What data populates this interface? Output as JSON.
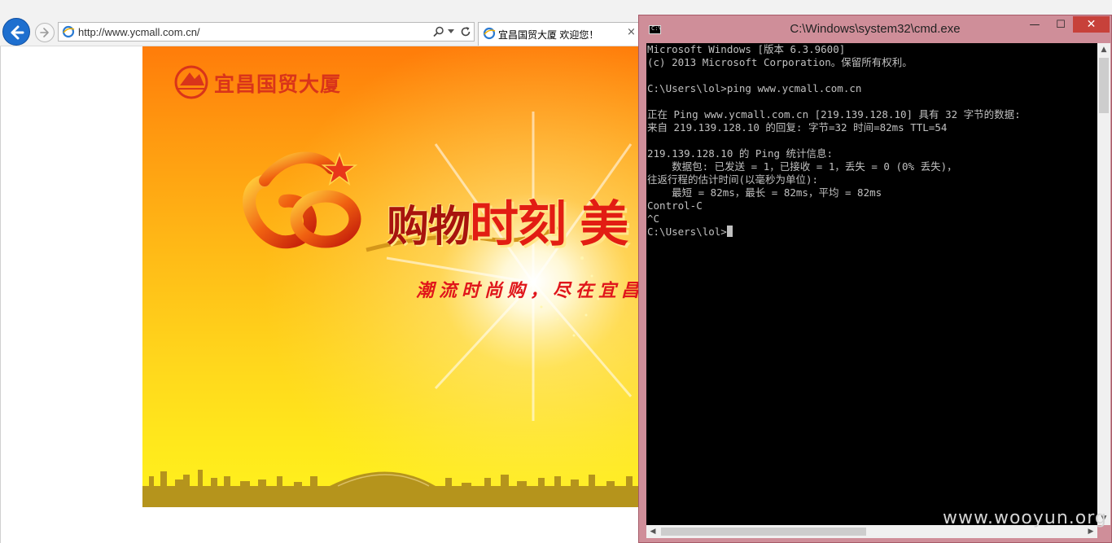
{
  "browser": {
    "url": "http://www.ycmall.com.cn/",
    "tab_title": "宜昌国贸大厦 欢迎您！",
    "tab_close": "×"
  },
  "banner": {
    "logo_text": "宜昌国贸大厦",
    "slogan_part1": "购物",
    "slogan_part2": "时刻",
    "slogan_part3": "美",
    "slogan_sub": "潮流时尚购，尽在宜昌"
  },
  "cmd": {
    "title": "C:\\Windows\\system32\\cmd.exe",
    "minimize": "—",
    "maximize": "☐",
    "close": "✕",
    "output": "Microsoft Windows [版本 6.3.9600]\n(c) 2013 Microsoft Corporation。保留所有权利。\n\nC:\\Users\\lol>ping www.ycmall.com.cn\n\n正在 Ping www.ycmall.com.cn [219.139.128.10] 具有 32 字节的数据:\n来自 219.139.128.10 的回复: 字节=32 时间=82ms TTL=54\n\n219.139.128.10 的 Ping 统计信息:\n    数据包: 已发送 = 1，已接收 = 1，丢失 = 0 (0% 丢失)，\n往返行程的估计时间(以毫秒为单位):\n    最短 = 82ms，最长 = 82ms，平均 = 82ms\nControl-C\n^C\nC:\\Users\\lol>"
  },
  "background_window": {
    "minimize": "—",
    "maximize": "❐",
    "close": "✕"
  },
  "watermark": "www.wooyun.org",
  "colors": {
    "cmd_frame": "#cf8e99",
    "console_bg": "#000000",
    "console_fg": "#c0c0c0",
    "close_button": "#c7413a",
    "browser_accent": "#1e6fcf"
  },
  "icons": [
    "back-arrow-icon",
    "forward-arrow-icon",
    "ie-page-icon",
    "search-icon",
    "dropdown-icon",
    "refresh-icon",
    "cmd-icon"
  ]
}
